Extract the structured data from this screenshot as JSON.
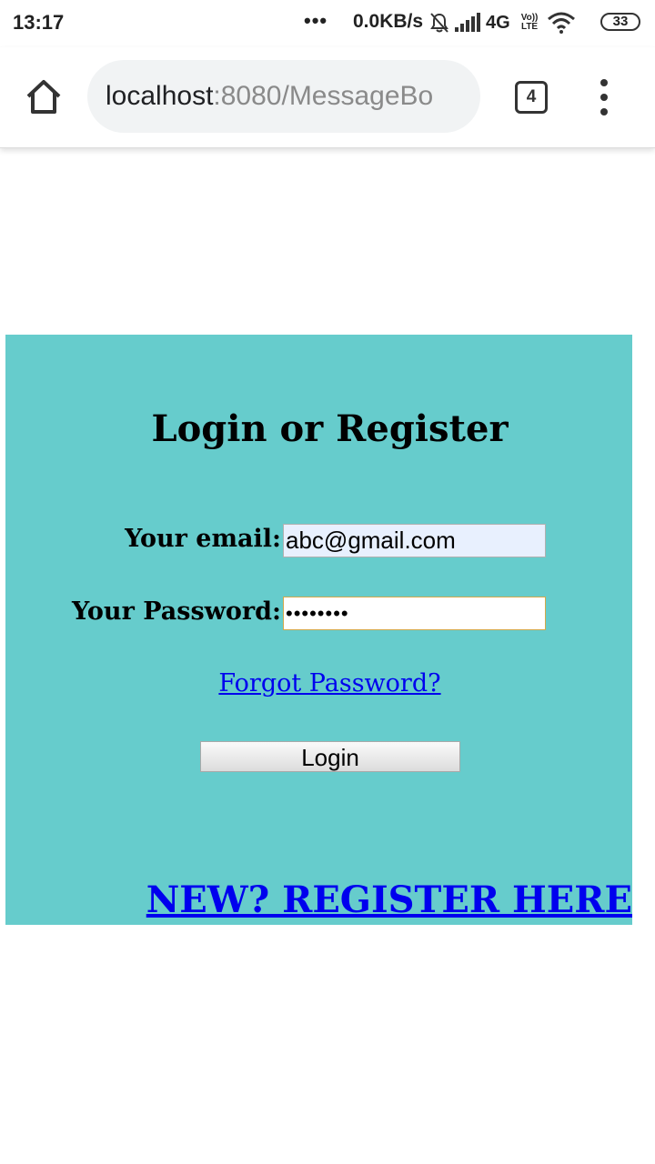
{
  "status_bar": {
    "time": "13:17",
    "dots": "•••",
    "speed": "0.0KB/s",
    "network": "4G",
    "volte_top": "Vo))",
    "volte_bottom": "LTE",
    "battery": "33"
  },
  "browser": {
    "url_host": "localhost",
    "url_path": ":8080/MessageBo",
    "tab_count": "4"
  },
  "login": {
    "title": "Login or Register",
    "email_label": "Your email:",
    "email_value": "abc@gmail.com",
    "password_label": "Your Password:",
    "password_value": "••••••••",
    "forgot_link": "Forgot Password?",
    "login_button": "Login",
    "register_link": "NEW? REGISTER HERE"
  },
  "colors": {
    "panel_background": "#66cccc",
    "link": "#0000ee",
    "email_autofill": "#e8f0fe",
    "password_focus_border": "#d4a84a"
  }
}
